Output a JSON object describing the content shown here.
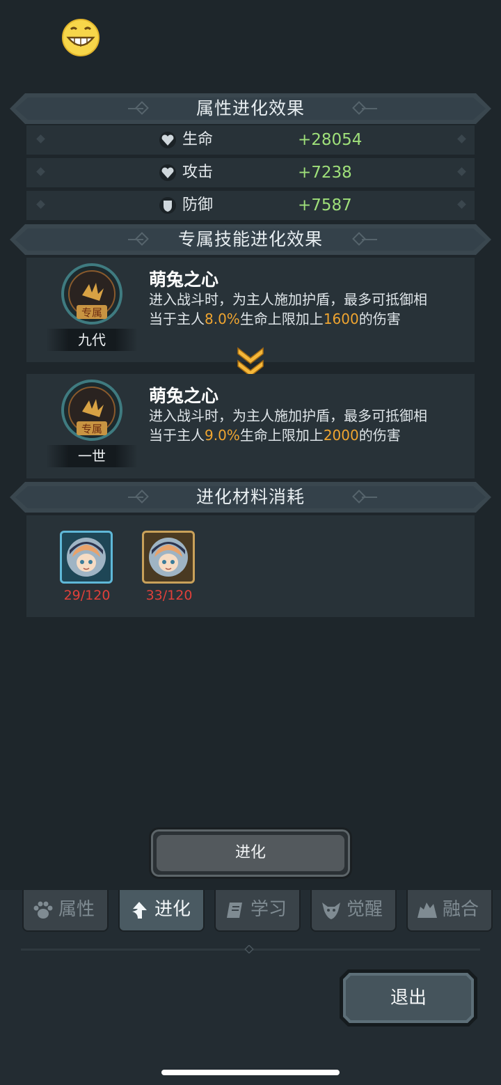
{
  "sections": {
    "attributes_title": "属性进化效果",
    "skill_title": "专属技能进化效果",
    "materials_title": "进化材料消耗"
  },
  "stats": [
    {
      "label": "生命",
      "value": "+28054",
      "icon": "heart-shield-icon"
    },
    {
      "label": "攻击",
      "value": "+7238",
      "icon": "heart-shield-icon"
    },
    {
      "label": "防御",
      "value": "+7587",
      "icon": "shield-icon"
    }
  ],
  "skill_current": {
    "emblem_text": "专属",
    "generation": "九代",
    "name": "萌兔之心",
    "desc_line1": "进入战斗时，为主人施加护盾，最多可抵御相",
    "desc_pre": "当于主人",
    "percent": "8.0%",
    "desc_mid": "生命上限加上",
    "flat": "1600",
    "desc_post": "的伤害"
  },
  "skill_next": {
    "emblem_text": "专属",
    "generation": "一世",
    "name": "萌兔之心",
    "desc_line1": "进入战斗时，为主人施加护盾，最多可抵御相",
    "desc_pre": "当于主人",
    "percent": "9.0%",
    "desc_mid": "生命上限加上",
    "flat": "2000",
    "desc_post": "的伤害"
  },
  "materials": [
    {
      "count": "29/120",
      "frame_color": "#5fb8d8"
    },
    {
      "count": "33/120",
      "frame_color": "#c9a15a"
    }
  ],
  "evolve_button": "进化",
  "tabs": [
    {
      "label": "属性",
      "icon": "paw-icon",
      "active": false
    },
    {
      "label": "进化",
      "icon": "evolve-arrow-icon",
      "active": true
    },
    {
      "label": "学习",
      "icon": "book-icon",
      "active": false
    },
    {
      "label": "觉醒",
      "icon": "awaken-head-icon",
      "active": false
    },
    {
      "label": "融合",
      "icon": "fusion-icon",
      "active": false
    }
  ],
  "exit_button": "退出",
  "colors": {
    "value_green": "#9fe07a",
    "highlight_orange": "#f0a530",
    "count_red": "#e0403a",
    "background": "#1e262b"
  }
}
